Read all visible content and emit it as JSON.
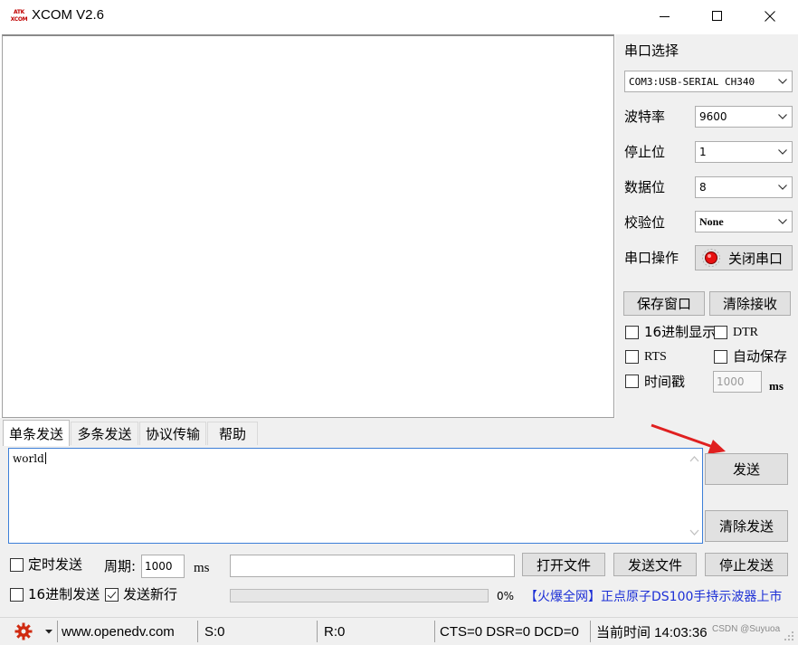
{
  "window": {
    "title": "XCOM V2.6",
    "logo_text": [
      "ATK",
      "XCOM"
    ]
  },
  "right_panel": {
    "port_select_label": "串口选择",
    "port_value": "COM3:USB-SERIAL CH340",
    "baud_label": "波特率",
    "baud_value": "9600",
    "stop_bits_label": "停止位",
    "stop_bits_value": "1",
    "data_bits_label": "数据位",
    "data_bits_value": "8",
    "parity_label": "校验位",
    "parity_value": "None",
    "port_op_label": "串口操作",
    "close_port_label": "关闭串口",
    "save_window_label": "保存窗口",
    "clear_receive_label": "清除接收",
    "hex_display_label": "16进制显示",
    "dtr_label": "DTR",
    "rts_label": "RTS",
    "auto_save_label": "自动保存",
    "timestamp_label": "时间戳",
    "timestamp_value": "1000",
    "timestamp_unit": "ms"
  },
  "tabs": [
    "单条发送",
    "多条发送",
    "协议传输",
    "帮助"
  ],
  "send_area": {
    "text": "world"
  },
  "buttons": {
    "send": "发送",
    "clear_send": "清除发送",
    "open_file": "打开文件",
    "send_file": "发送文件",
    "stop_send": "停止发送"
  },
  "bottom": {
    "timed_send_label": "定时发送",
    "period_label": "周期:",
    "period_value": "1000",
    "period_unit": "ms",
    "hex_send_label": "16进制发送",
    "send_newline_label": "发送新行",
    "send_newline_checked": true,
    "progress_percent": "0%",
    "ad_text": "【火爆全网】正点原子DS100手持示波器上市"
  },
  "statusbar": {
    "url": "www.openedv.com",
    "sent": "S:0",
    "received": "R:0",
    "signals": "CTS=0 DSR=0 DCD=0",
    "time_label": "当前时间 14:03:36",
    "watermark": "CSDN @Suyuoa"
  },
  "colors": {
    "ad_text": "#1c2fd6",
    "logo": "#c00000",
    "gear": "#d02a10",
    "annotation_arrow": "#e02020",
    "tx_border": "#3d7fd8"
  }
}
